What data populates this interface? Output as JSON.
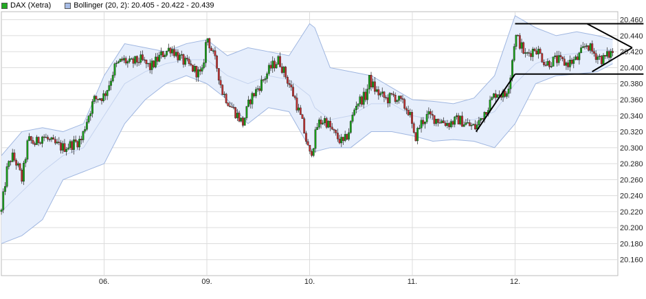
{
  "legend": {
    "items": [
      {
        "label": "DAX (Xetra)",
        "color": "#22aa22"
      },
      {
        "label": "Bollinger (20, 2): 20.405 - 20.422 - 20.439",
        "color": "#a8bde6"
      }
    ]
  },
  "colors": {
    "up": "#18a018",
    "down": "#c03030",
    "band_fill": "#e6eefc",
    "band_line": "#9fb6e0",
    "grid": "#dcdcdc",
    "trendline": "#000000"
  },
  "chart_data": {
    "type": "candlestick",
    "title": "",
    "xlabel": "",
    "ylabel": "",
    "ylim": [
      20140,
      20470
    ],
    "yticks": [
      "20.160",
      "20.180",
      "20.200",
      "20.220",
      "20.240",
      "20.260",
      "20.280",
      "20.300",
      "20.320",
      "20.340",
      "20.360",
      "20.380",
      "20.400",
      "20.420",
      "20.440",
      "20.460"
    ],
    "ytick_values": [
      20160,
      20180,
      20200,
      20220,
      20240,
      20260,
      20280,
      20300,
      20320,
      20340,
      20360,
      20380,
      20400,
      20420,
      20440,
      20460
    ],
    "xticks": [
      "06.",
      "09.",
      "10.",
      "11.",
      "12."
    ],
    "xtick_positions": [
      1,
      2,
      3,
      4,
      5
    ],
    "x_domain": [
      0,
      6
    ],
    "grid": true,
    "close_path": [
      [
        0.0,
        20220
      ],
      [
        0.05,
        20270
      ],
      [
        0.1,
        20290
      ],
      [
        0.15,
        20280
      ],
      [
        0.2,
        20260
      ],
      [
        0.26,
        20310
      ],
      [
        0.33,
        20305
      ],
      [
        0.4,
        20315
      ],
      [
        0.5,
        20305
      ],
      [
        0.6,
        20300
      ],
      [
        0.7,
        20305
      ],
      [
        0.78,
        20310
      ],
      [
        0.82,
        20330
      ],
      [
        0.9,
        20360
      ],
      [
        1.0,
        20365
      ],
      [
        1.05,
        20380
      ],
      [
        1.1,
        20400
      ],
      [
        1.18,
        20410
      ],
      [
        1.25,
        20405
      ],
      [
        1.35,
        20410
      ],
      [
        1.45,
        20400
      ],
      [
        1.55,
        20415
      ],
      [
        1.65,
        20425
      ],
      [
        1.75,
        20410
      ],
      [
        1.85,
        20400
      ],
      [
        1.95,
        20390
      ],
      [
        2.0,
        20440
      ],
      [
        2.05,
        20420
      ],
      [
        2.1,
        20400
      ],
      [
        2.15,
        20370
      ],
      [
        2.22,
        20355
      ],
      [
        2.3,
        20340
      ],
      [
        2.35,
        20330
      ],
      [
        2.42,
        20360
      ],
      [
        2.5,
        20375
      ],
      [
        2.55,
        20385
      ],
      [
        2.62,
        20400
      ],
      [
        2.7,
        20410
      ],
      [
        2.75,
        20395
      ],
      [
        2.8,
        20380
      ],
      [
        2.86,
        20360
      ],
      [
        2.93,
        20330
      ],
      [
        3.0,
        20290
      ],
      [
        3.03,
        20300
      ],
      [
        3.08,
        20330
      ],
      [
        3.15,
        20335
      ],
      [
        3.25,
        20315
      ],
      [
        3.33,
        20305
      ],
      [
        3.38,
        20320
      ],
      [
        3.45,
        20355
      ],
      [
        3.55,
        20365
      ],
      [
        3.58,
        20385
      ],
      [
        3.65,
        20370
      ],
      [
        3.75,
        20360
      ],
      [
        3.82,
        20365
      ],
      [
        3.9,
        20355
      ],
      [
        3.97,
        20345
      ],
      [
        4.02,
        20310
      ],
      [
        4.08,
        20330
      ],
      [
        4.15,
        20340
      ],
      [
        4.25,
        20335
      ],
      [
        4.35,
        20330
      ],
      [
        4.45,
        20335
      ],
      [
        4.55,
        20328
      ],
      [
        4.62,
        20325
      ],
      [
        4.68,
        20340
      ],
      [
        4.75,
        20355
      ],
      [
        4.82,
        20370
      ],
      [
        4.9,
        20365
      ],
      [
        4.95,
        20385
      ],
      [
        5.0,
        20440
      ],
      [
        5.03,
        20435
      ],
      [
        5.1,
        20415
      ],
      [
        5.2,
        20425
      ],
      [
        5.3,
        20405
      ],
      [
        5.4,
        20410
      ],
      [
        5.5,
        20405
      ],
      [
        5.6,
        20410
      ],
      [
        5.7,
        20430
      ],
      [
        5.75,
        20420
      ],
      [
        5.85,
        20410
      ],
      [
        5.95,
        20420
      ]
    ],
    "bands": {
      "x": [
        0.0,
        0.2,
        0.4,
        0.6,
        0.8,
        1.0,
        1.2,
        1.4,
        1.6,
        1.8,
        2.0,
        2.2,
        2.4,
        2.6,
        2.8,
        3.0,
        3.05,
        3.2,
        3.4,
        3.6,
        3.8,
        4.0,
        4.2,
        4.4,
        4.6,
        4.8,
        5.0,
        5.2,
        5.4,
        5.6,
        5.8,
        5.95
      ],
      "upper": [
        20290,
        20320,
        20325,
        20320,
        20330,
        20390,
        20430,
        20425,
        20420,
        20430,
        20435,
        20415,
        20425,
        20420,
        20415,
        20455,
        20450,
        20400,
        20395,
        20390,
        20375,
        20360,
        20358,
        20355,
        20362,
        20390,
        20465,
        20450,
        20440,
        20445,
        20440,
        20435
      ],
      "middle": [
        20220,
        20245,
        20270,
        20290,
        20300,
        20340,
        20380,
        20395,
        20405,
        20410,
        20410,
        20390,
        20380,
        20390,
        20385,
        20365,
        20350,
        20335,
        20340,
        20355,
        20355,
        20340,
        20335,
        20333,
        20335,
        20345,
        20380,
        20405,
        20415,
        20418,
        20422,
        20422
      ],
      "lower": [
        20180,
        20190,
        20210,
        20260,
        20270,
        20280,
        20330,
        20360,
        20380,
        20390,
        20380,
        20360,
        20330,
        20350,
        20345,
        20300,
        20295,
        20300,
        20300,
        20320,
        20320,
        20315,
        20308,
        20310,
        20308,
        20300,
        20330,
        20380,
        20390,
        20392,
        20395,
        20405
      ]
    },
    "trendlines": [
      {
        "from": [
          5.0,
          20455
        ],
        "to": [
          6.25,
          20455
        ]
      },
      {
        "from": [
          5.0,
          20392
        ],
        "to": [
          6.25,
          20392
        ]
      },
      {
        "from": [
          4.62,
          20320
        ],
        "to": [
          5.0,
          20392
        ]
      },
      {
        "from": [
          5.7,
          20455
        ],
        "to": [
          6.14,
          20425
        ]
      },
      {
        "from": [
          5.75,
          20395
        ],
        "to": [
          6.14,
          20425
        ]
      }
    ]
  }
}
